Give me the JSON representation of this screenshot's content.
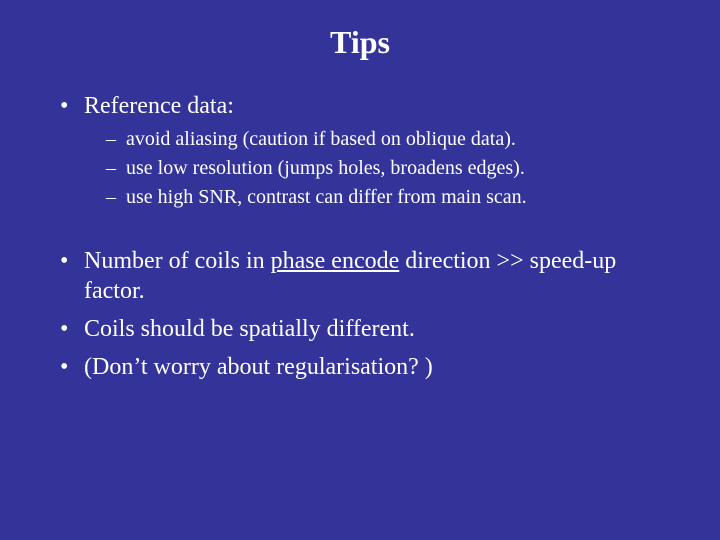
{
  "title": "Tips",
  "bullets": {
    "b1": "Reference data:",
    "b1_sub": [
      "avoid aliasing (caution if based on oblique data).",
      "use low resolution (jumps holes, broadens edges).",
      "use high SNR, contrast can differ from main scan."
    ],
    "b2_pre": "Number of coils in ",
    "b2_underline": "phase encode",
    "b2_post": " direction >> speed-up factor.",
    "b3": "Coils should be spatially different.",
    "b4": "(Don’t worry about regularisation? )"
  }
}
